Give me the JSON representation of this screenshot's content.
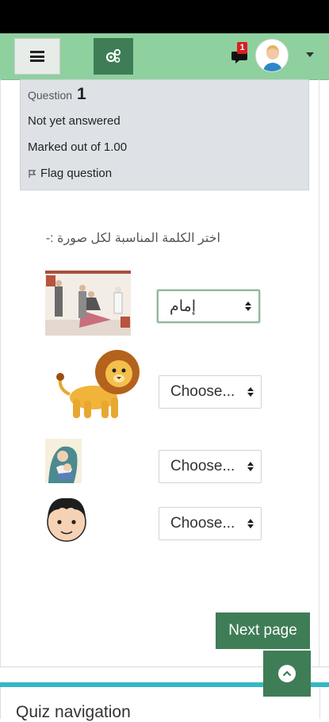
{
  "question": {
    "label": "Question",
    "number": "1",
    "state": "Not yet answered",
    "marks": "Marked out of 1.00",
    "flag_label": "Flag question"
  },
  "notifications": {
    "count": "1"
  },
  "instruction": "اختر الكلمة المناسبة لكل صورة :-",
  "answers": [
    {
      "image": "people-standing-picture",
      "selected": "إمام"
    },
    {
      "image": "lion-picture",
      "selected": "Choose..."
    },
    {
      "image": "mother-child-picture",
      "selected": "Choose..."
    },
    {
      "image": "boy-face-picture",
      "selected": "Choose..."
    }
  ],
  "buttons": {
    "next_page": "Next page"
  },
  "quiz_navigation": {
    "title": "Quiz navigation"
  },
  "colors": {
    "navbar": "#8fd09f",
    "primary": "#3f7d56",
    "accent": "#35b7c5",
    "badge": "#d71f1f"
  }
}
